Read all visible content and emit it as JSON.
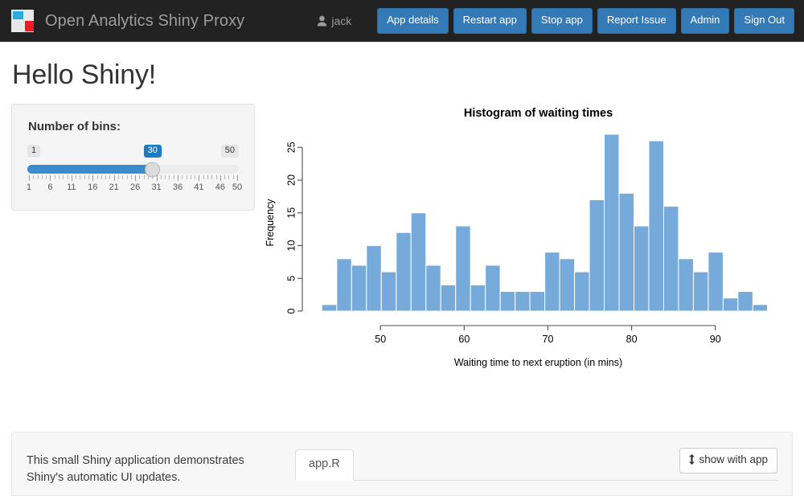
{
  "navbar": {
    "brand_title": "Open Analytics Shiny Proxy",
    "logo_icon": "shinyproxy-squares-logo",
    "user": {
      "icon": "user-icon",
      "name": "jack"
    },
    "buttons": [
      {
        "label": "App details",
        "name": "app-details"
      },
      {
        "label": "Restart app",
        "name": "restart-app"
      },
      {
        "label": "Stop app",
        "name": "stop-app"
      },
      {
        "label": "Report Issue",
        "name": "report-issue"
      },
      {
        "label": "Admin",
        "name": "admin"
      },
      {
        "label": "Sign Out",
        "name": "sign-out"
      }
    ],
    "background": "#222222",
    "button_color": "#337ab7"
  },
  "page": {
    "title": "Hello Shiny!"
  },
  "sidebar": {
    "slider": {
      "label": "Number of bins:",
      "min": "1",
      "max": "50",
      "value": "30",
      "tick_labels": [
        "1",
        "6",
        "11",
        "16",
        "21",
        "26",
        "31",
        "36",
        "41",
        "46",
        "50"
      ],
      "fill_color": "#3a8ccc",
      "value_badge_color": "#1f7bc1"
    }
  },
  "chart_data": {
    "type": "bar",
    "title": "Histogram of waiting times",
    "xlabel": "Waiting time to next eruption (in mins)",
    "ylabel": "Frequency",
    "bar_color": "#75aadb",
    "bar_border": "#ffffff",
    "grid": false,
    "legend": "none",
    "bins": 30,
    "xlim": [
      42.2,
      95.5
    ],
    "ylim": [
      0,
      27
    ],
    "xticks": [
      50,
      60,
      70,
      80,
      90
    ],
    "yticks": [
      0,
      5,
      10,
      15,
      20,
      25
    ],
    "bin_edges": [
      43.0,
      44.78,
      46.55,
      48.33,
      50.1,
      51.88,
      53.65,
      55.43,
      57.2,
      58.98,
      60.75,
      62.53,
      64.3,
      66.08,
      67.85,
      69.63,
      71.4,
      73.18,
      74.95,
      76.73,
      78.5,
      80.28,
      82.05,
      83.83,
      85.6,
      87.38,
      89.15,
      90.93,
      92.7,
      94.48,
      96.25
    ],
    "values": [
      1,
      8,
      7,
      10,
      6,
      12,
      15,
      7,
      4,
      13,
      4,
      7,
      3,
      3,
      3,
      9,
      8,
      6,
      17,
      27,
      18,
      13,
      26,
      16,
      8,
      6,
      9,
      2,
      3,
      1
    ]
  },
  "footer": {
    "description": "This small Shiny application demonstrates Shiny's automatic UI updates.",
    "tabs": [
      {
        "label": "app.R",
        "active": true
      }
    ],
    "show_button": {
      "label": "show with app",
      "icon": "arrows-vertical-icon"
    }
  }
}
